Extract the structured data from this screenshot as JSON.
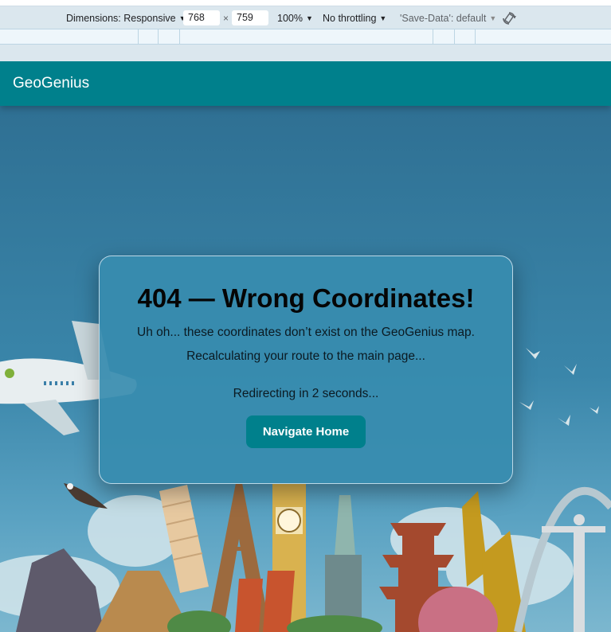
{
  "devtools": {
    "dimensions_label": "Dimensions: Responsive",
    "width_value": "768",
    "height_value": "759",
    "times_sign": "×",
    "zoom_label": "100%",
    "throttling_label": "No throttling",
    "save_data_label": "'Save-Data': default"
  },
  "app": {
    "brand": "GeoGenius",
    "error_title": "404 — Wrong Coordinates!",
    "message_line1": "Uh oh... these coordinates don’t exist on the GeoGenius map.",
    "message_line2": "Recalculating your route to the main page...",
    "redirect_text": "Redirecting in 2 seconds...",
    "home_button_label": "Navigate Home"
  },
  "colors": {
    "appbar": "#00808c",
    "button": "#00808c",
    "card": "#378caf",
    "sky_top": "#2d6c8f",
    "sky_bottom": "#7cb7cf"
  }
}
